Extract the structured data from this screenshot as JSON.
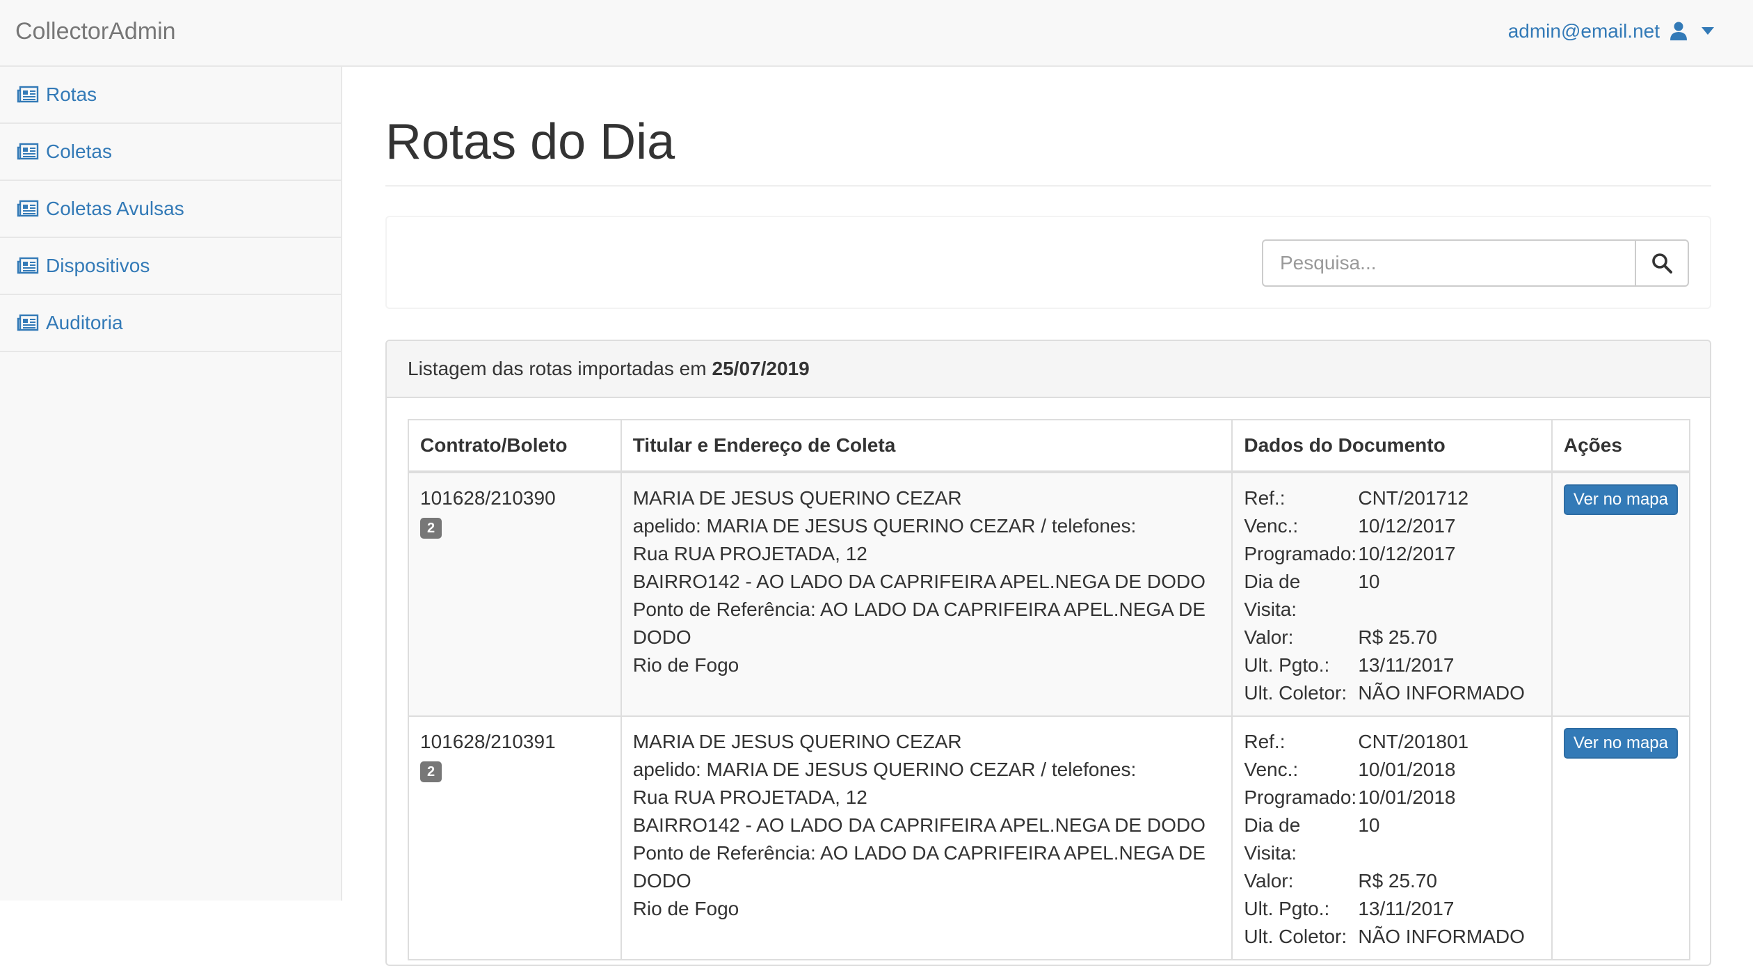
{
  "app": {
    "brand": "CollectorAdmin",
    "user_email": "admin@email.net"
  },
  "sidebar": {
    "items": [
      {
        "label": "Rotas",
        "icon": "newspaper-icon"
      },
      {
        "label": "Coletas",
        "icon": "newspaper-icon"
      },
      {
        "label": "Coletas Avulsas",
        "icon": "newspaper-icon"
      },
      {
        "label": "Dispositivos",
        "icon": "newspaper-icon"
      },
      {
        "label": "Auditoria",
        "icon": "newspaper-icon"
      }
    ]
  },
  "main": {
    "title": "Rotas do Dia",
    "search": {
      "placeholder": "Pesquisa...",
      "value": ""
    },
    "panel": {
      "heading_prefix": "Listagem das rotas importadas em",
      "heading_date": "25/07/2019"
    },
    "table": {
      "headers": [
        "Contrato/Boleto",
        "Titular e Endereço de Coleta",
        "Dados do Documento",
        "Ações"
      ],
      "doc_labels": [
        "Ref.:",
        "Venc.:",
        "Programado:",
        "Dia de Visita:",
        "Valor:",
        "Ult. Pgto.:",
        "Ult. Coletor:"
      ],
      "rows": [
        {
          "contract": "101628/210390",
          "badge": "2",
          "name": "MARIA DE JESUS QUERINO CEZAR",
          "apelido": "apelido: MARIA DE JESUS QUERINO CEZAR / telefones:",
          "street": "Rua RUA PROJETADA, 12",
          "bairro": "BAIRRO142 - AO LADO DA CAPRIFEIRA APEL.NEGA DE DODO",
          "referencia": "Ponto de Referência: AO LADO DA CAPRIFEIRA APEL.NEGA DE DODO",
          "city": "Rio de Fogo",
          "doc": [
            "CNT/201712",
            "10/12/2017",
            "10/12/2017",
            "10",
            "R$ 25.70",
            "13/11/2017",
            "NÃO INFORMADO"
          ],
          "action": "Ver no mapa"
        },
        {
          "contract": "101628/210391",
          "badge": "2",
          "name": "MARIA DE JESUS QUERINO CEZAR",
          "apelido": "apelido: MARIA DE JESUS QUERINO CEZAR / telefones:",
          "street": "Rua RUA PROJETADA, 12",
          "bairro": "BAIRRO142 - AO LADO DA CAPRIFEIRA APEL.NEGA DE DODO",
          "referencia": "Ponto de Referência: AO LADO DA CAPRIFEIRA APEL.NEGA DE DODO",
          "city": "Rio de Fogo",
          "doc": [
            "CNT/201801",
            "10/01/2018",
            "10/01/2018",
            "10",
            "R$ 25.70",
            "13/11/2017",
            "NÃO INFORMADO"
          ],
          "action": "Ver no mapa"
        }
      ]
    }
  },
  "colors": {
    "link": "#337ab7",
    "badge": "#777777",
    "navbar_bg": "#f8f8f8"
  }
}
